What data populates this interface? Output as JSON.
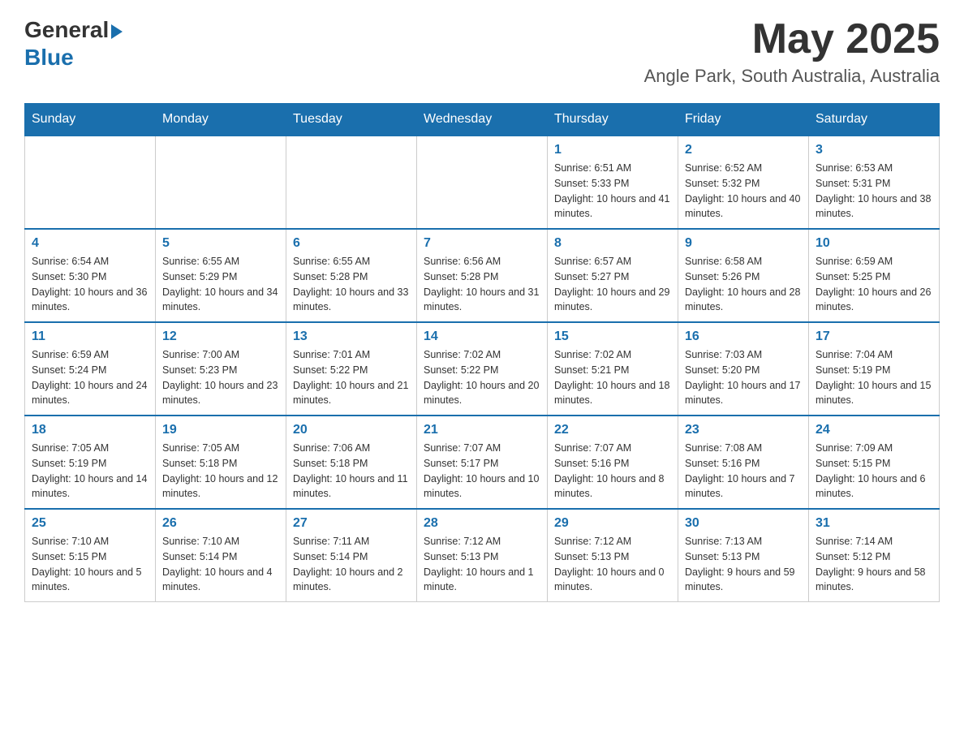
{
  "header": {
    "logo_general": "General",
    "logo_blue": "Blue",
    "main_title": "May 2025",
    "subtitle": "Angle Park, South Australia, Australia"
  },
  "calendar": {
    "days_of_week": [
      "Sunday",
      "Monday",
      "Tuesday",
      "Wednesday",
      "Thursday",
      "Friday",
      "Saturday"
    ],
    "weeks": [
      [
        {
          "day": "",
          "info": ""
        },
        {
          "day": "",
          "info": ""
        },
        {
          "day": "",
          "info": ""
        },
        {
          "day": "",
          "info": ""
        },
        {
          "day": "1",
          "info": "Sunrise: 6:51 AM\nSunset: 5:33 PM\nDaylight: 10 hours and 41 minutes."
        },
        {
          "day": "2",
          "info": "Sunrise: 6:52 AM\nSunset: 5:32 PM\nDaylight: 10 hours and 40 minutes."
        },
        {
          "day": "3",
          "info": "Sunrise: 6:53 AM\nSunset: 5:31 PM\nDaylight: 10 hours and 38 minutes."
        }
      ],
      [
        {
          "day": "4",
          "info": "Sunrise: 6:54 AM\nSunset: 5:30 PM\nDaylight: 10 hours and 36 minutes."
        },
        {
          "day": "5",
          "info": "Sunrise: 6:55 AM\nSunset: 5:29 PM\nDaylight: 10 hours and 34 minutes."
        },
        {
          "day": "6",
          "info": "Sunrise: 6:55 AM\nSunset: 5:28 PM\nDaylight: 10 hours and 33 minutes."
        },
        {
          "day": "7",
          "info": "Sunrise: 6:56 AM\nSunset: 5:28 PM\nDaylight: 10 hours and 31 minutes."
        },
        {
          "day": "8",
          "info": "Sunrise: 6:57 AM\nSunset: 5:27 PM\nDaylight: 10 hours and 29 minutes."
        },
        {
          "day": "9",
          "info": "Sunrise: 6:58 AM\nSunset: 5:26 PM\nDaylight: 10 hours and 28 minutes."
        },
        {
          "day": "10",
          "info": "Sunrise: 6:59 AM\nSunset: 5:25 PM\nDaylight: 10 hours and 26 minutes."
        }
      ],
      [
        {
          "day": "11",
          "info": "Sunrise: 6:59 AM\nSunset: 5:24 PM\nDaylight: 10 hours and 24 minutes."
        },
        {
          "day": "12",
          "info": "Sunrise: 7:00 AM\nSunset: 5:23 PM\nDaylight: 10 hours and 23 minutes."
        },
        {
          "day": "13",
          "info": "Sunrise: 7:01 AM\nSunset: 5:22 PM\nDaylight: 10 hours and 21 minutes."
        },
        {
          "day": "14",
          "info": "Sunrise: 7:02 AM\nSunset: 5:22 PM\nDaylight: 10 hours and 20 minutes."
        },
        {
          "day": "15",
          "info": "Sunrise: 7:02 AM\nSunset: 5:21 PM\nDaylight: 10 hours and 18 minutes."
        },
        {
          "day": "16",
          "info": "Sunrise: 7:03 AM\nSunset: 5:20 PM\nDaylight: 10 hours and 17 minutes."
        },
        {
          "day": "17",
          "info": "Sunrise: 7:04 AM\nSunset: 5:19 PM\nDaylight: 10 hours and 15 minutes."
        }
      ],
      [
        {
          "day": "18",
          "info": "Sunrise: 7:05 AM\nSunset: 5:19 PM\nDaylight: 10 hours and 14 minutes."
        },
        {
          "day": "19",
          "info": "Sunrise: 7:05 AM\nSunset: 5:18 PM\nDaylight: 10 hours and 12 minutes."
        },
        {
          "day": "20",
          "info": "Sunrise: 7:06 AM\nSunset: 5:18 PM\nDaylight: 10 hours and 11 minutes."
        },
        {
          "day": "21",
          "info": "Sunrise: 7:07 AM\nSunset: 5:17 PM\nDaylight: 10 hours and 10 minutes."
        },
        {
          "day": "22",
          "info": "Sunrise: 7:07 AM\nSunset: 5:16 PM\nDaylight: 10 hours and 8 minutes."
        },
        {
          "day": "23",
          "info": "Sunrise: 7:08 AM\nSunset: 5:16 PM\nDaylight: 10 hours and 7 minutes."
        },
        {
          "day": "24",
          "info": "Sunrise: 7:09 AM\nSunset: 5:15 PM\nDaylight: 10 hours and 6 minutes."
        }
      ],
      [
        {
          "day": "25",
          "info": "Sunrise: 7:10 AM\nSunset: 5:15 PM\nDaylight: 10 hours and 5 minutes."
        },
        {
          "day": "26",
          "info": "Sunrise: 7:10 AM\nSunset: 5:14 PM\nDaylight: 10 hours and 4 minutes."
        },
        {
          "day": "27",
          "info": "Sunrise: 7:11 AM\nSunset: 5:14 PM\nDaylight: 10 hours and 2 minutes."
        },
        {
          "day": "28",
          "info": "Sunrise: 7:12 AM\nSunset: 5:13 PM\nDaylight: 10 hours and 1 minute."
        },
        {
          "day": "29",
          "info": "Sunrise: 7:12 AM\nSunset: 5:13 PM\nDaylight: 10 hours and 0 minutes."
        },
        {
          "day": "30",
          "info": "Sunrise: 7:13 AM\nSunset: 5:13 PM\nDaylight: 9 hours and 59 minutes."
        },
        {
          "day": "31",
          "info": "Sunrise: 7:14 AM\nSunset: 5:12 PM\nDaylight: 9 hours and 58 minutes."
        }
      ]
    ]
  }
}
